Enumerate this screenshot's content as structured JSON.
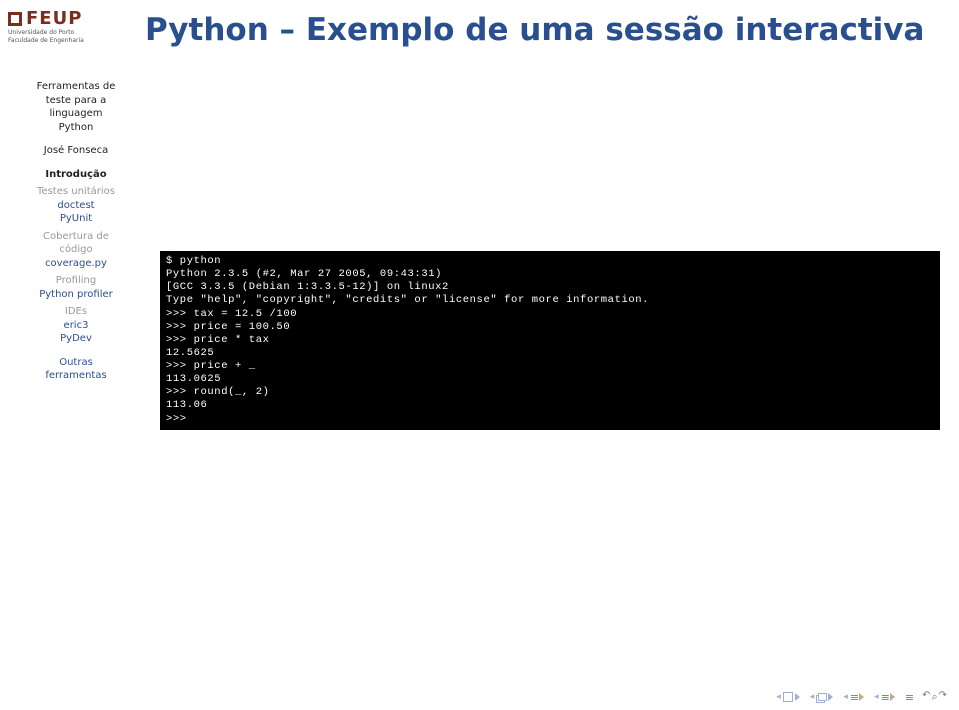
{
  "logo": {
    "text": "FEUP",
    "sub1": "Universidade do Porto",
    "sub2": "Faculdade de Engenharia"
  },
  "title": "Python – Exemplo de uma sessão interactiva",
  "sidebar": {
    "course1": "Ferramentas de",
    "course2": "teste para a",
    "course3": "linguagem",
    "course4": "Python",
    "author": "José Fonseca",
    "sections": {
      "intro": "Introdução",
      "testes": "Testes unitários",
      "doctest": "doctest",
      "pyunit": "PyUnit",
      "cobertura1": "Cobertura de",
      "cobertura2": "código",
      "coveragepy": "coverage.py",
      "profiling": "Profiling",
      "pyprofiler": "Python profiler",
      "ides": "IDEs",
      "eric3": "eric3",
      "pydev": "PyDev",
      "outras1": "Outras",
      "outras2": "ferramentas"
    }
  },
  "terminal": {
    "lines": [
      "$ python",
      "Python 2.3.5 (#2, Mar 27 2005, 09:43:31)",
      "[GCC 3.3.5 (Debian 1:3.3.5-12)] on linux2",
      "Type \"help\", \"copyright\", \"credits\" or \"license\" for more information.",
      ">>> tax = 12.5 /100",
      ">>> price = 100.50",
      ">>> price * tax",
      "12.5625",
      ">>> price + _",
      "113.0625",
      ">>> round(_, 2)",
      "113.06",
      ">>>"
    ]
  }
}
